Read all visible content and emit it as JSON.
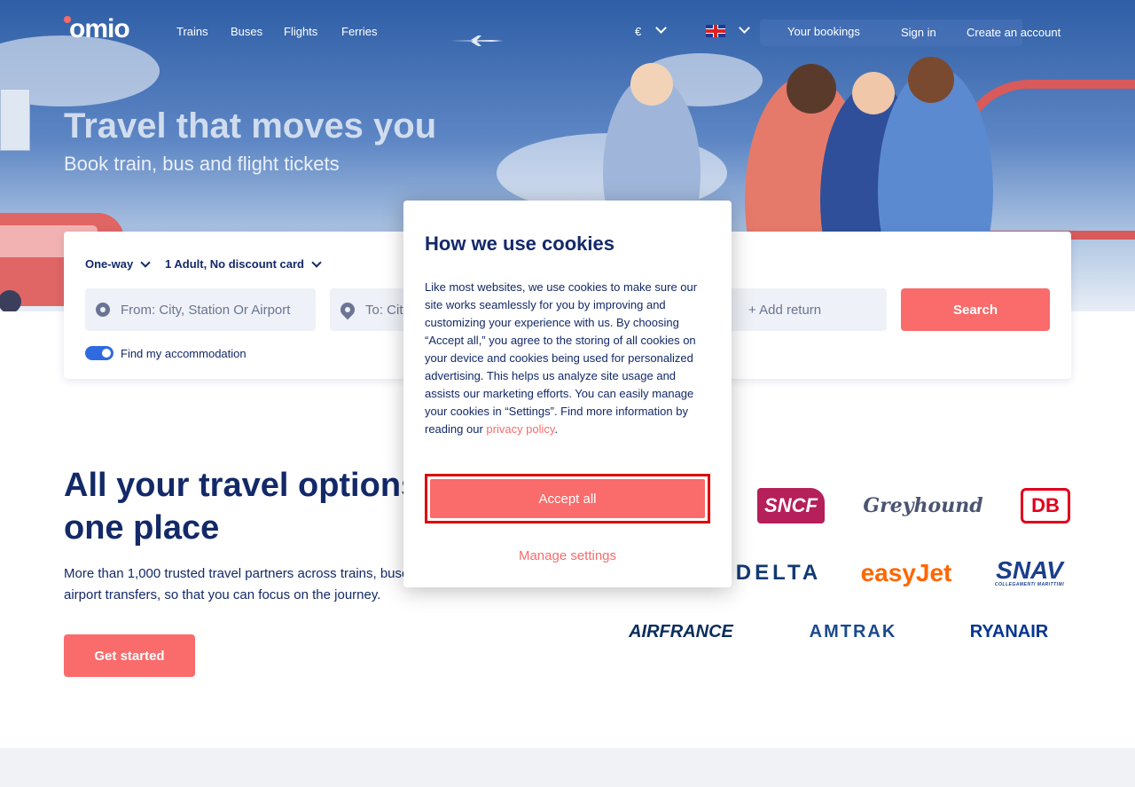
{
  "nav": {
    "logo": "omio",
    "links": [
      "Trains",
      "Buses",
      "Flights",
      "Ferries"
    ],
    "currency": "€",
    "language_icon": "uk-flag-icon",
    "your_bookings": "Your bookings",
    "sign_in": "Sign in",
    "create_account": "Create an account"
  },
  "hero": {
    "title": "Travel that moves you",
    "subtitle": "Book train, bus and flight tickets"
  },
  "search": {
    "trip_type": "One-way",
    "passengers": "1 Adult, No discount card",
    "from_placeholder": "From: City, Station Or Airport",
    "to_placeholder": "To: City, Station Or Airport",
    "add_return": "+ Add return",
    "search_button": "Search",
    "accommodation_toggle": "Find my accommodation"
  },
  "partners": {
    "title": "All your travel options in one place",
    "text": "More than 1,000 trusted travel partners across trains, buses, flights, ferries, and airport transfers, so that you can focus on the journey.",
    "cta": "Get started",
    "brands": [
      "SNCF",
      "Greyhound",
      "DB",
      "DELTA",
      "easyJet",
      "SNAV",
      "AIRFRANCE",
      "AMTRAK",
      "RYANAIR"
    ],
    "brand_subtext": "COLLEGAMENTI MARITTIMI"
  },
  "cookie_modal": {
    "title": "How we use cookies",
    "body": "Like most websites, we use cookies to make sure our site works seamlessly for you by improving and customizing your experience with us. By choosing “Accept all,” you agree to the storing of all cookies on your device and cookies being used for personalized advertising. This helps us analyze site usage and assists our marketing efforts. You can easily manage your cookies in “Settings”. Find more information by reading our ",
    "link": "privacy policy",
    "period": ".",
    "accept_all": "Accept all",
    "manage_settings": "Manage settings"
  },
  "colors": {
    "brand_coral": "#fa6b6b",
    "navy": "#132968",
    "highlight_border": "#e00000"
  }
}
